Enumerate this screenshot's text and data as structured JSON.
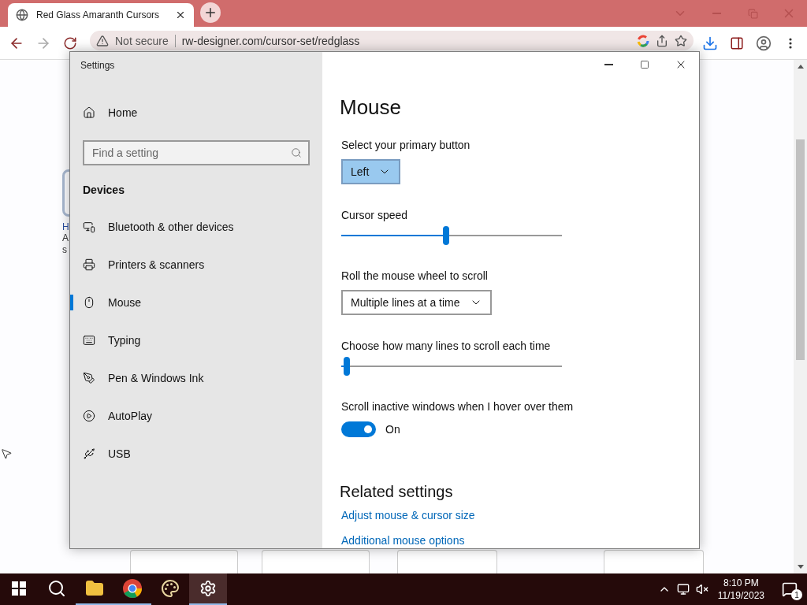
{
  "browser": {
    "tabs": [
      {
        "title": "Red Glass Amaranth Cursors",
        "selected": true
      }
    ],
    "address_bar": {
      "security": "Not secure",
      "url": "rw-designer.com/cursor-set/redglass"
    }
  },
  "background_page": {
    "fragments": [
      {
        "kind": "link",
        "text": "H"
      },
      {
        "kind": "text",
        "text": "A"
      },
      {
        "kind": "text",
        "text": "s"
      }
    ]
  },
  "settings_window": {
    "title": "Settings",
    "sidebar": {
      "home": "Home",
      "search": {
        "placeholder": "Find a setting"
      },
      "section": "Devices",
      "items": [
        {
          "kind": "devices",
          "label": "Bluetooth & other devices",
          "selected": false
        },
        {
          "kind": "printer",
          "label": "Printers & scanners",
          "selected": false
        },
        {
          "kind": "mouse",
          "label": "Mouse",
          "selected": true
        },
        {
          "kind": "keyboard",
          "label": "Typing",
          "selected": false
        },
        {
          "kind": "pen",
          "label": "Pen & Windows Ink",
          "selected": false
        },
        {
          "kind": "autoplay",
          "label": "AutoPlay",
          "selected": false
        },
        {
          "kind": "usb",
          "label": "USB",
          "selected": false
        }
      ]
    },
    "page": {
      "title": "Mouse",
      "settings": [
        {
          "kind": "dropdown",
          "label": "Select your primary button",
          "value": "Left",
          "focused": true
        },
        {
          "kind": "slider",
          "label": "Cursor speed",
          "level": 0.475
        },
        {
          "kind": "dropdown",
          "label": "Roll the mouse wheel to scroll",
          "value": "Multiple lines at a time",
          "focused": false
        },
        {
          "kind": "slider",
          "label": "Choose how many lines to scroll each time",
          "level": 0.01
        },
        {
          "kind": "toggle",
          "label": "Scroll inactive windows when I hover over them",
          "on": true,
          "state_text": "On"
        }
      ],
      "related": {
        "title": "Related settings",
        "links": [
          "Adjust mouse & cursor size",
          "Additional mouse options"
        ]
      }
    }
  },
  "taskbar": {
    "apps": [
      {
        "kind": "start",
        "selected": false,
        "running": false
      },
      {
        "kind": "search",
        "selected": false,
        "running": false
      },
      {
        "kind": "files",
        "selected": false,
        "running": true
      },
      {
        "kind": "browser",
        "selected": false,
        "running": true
      },
      {
        "kind": "paint",
        "selected": false,
        "running": false
      },
      {
        "kind": "settings",
        "selected": true,
        "running": true
      }
    ],
    "time": "8:10 PM",
    "date": "11/19/2023",
    "notifications": "1"
  }
}
